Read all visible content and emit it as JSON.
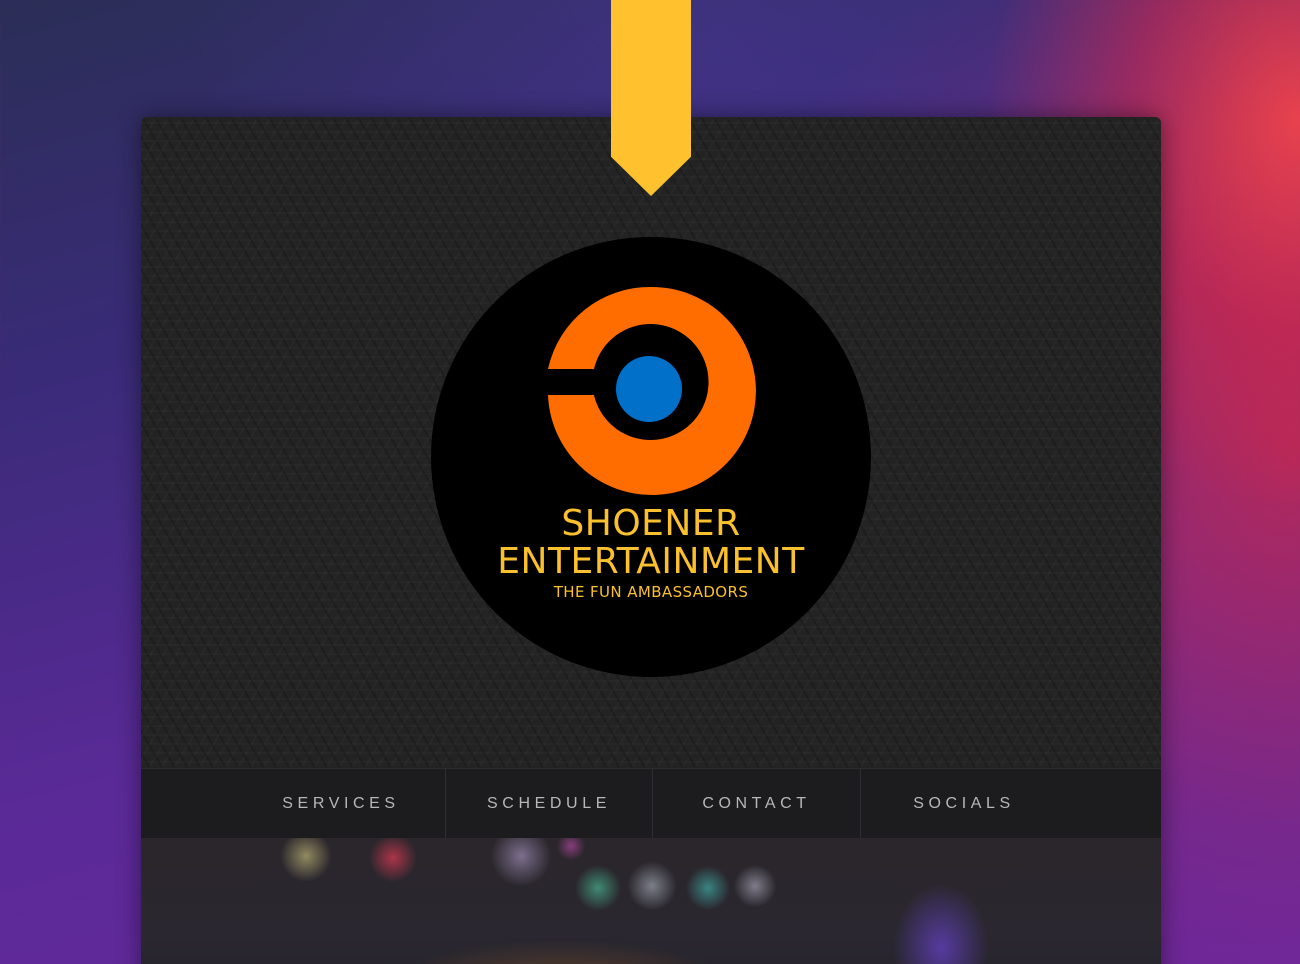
{
  "brand": {
    "name_line1": "SHOENER",
    "name_line2": "ENTERTAINMENT",
    "tagline": "THE FUN AMBASSADORS",
    "logo_mark": "orange-c-with-blue-dot-icon"
  },
  "nav": {
    "items": [
      {
        "label": "SERVICES"
      },
      {
        "label": "SCHEDULE"
      },
      {
        "label": "CONTACT"
      },
      {
        "label": "SOCIALS"
      }
    ]
  },
  "colors": {
    "accent_yellow": "#ffc12e",
    "logo_orange": "#ff6d00",
    "logo_blue": "#0070c9",
    "logo_text": "#fbc02d",
    "panel": "#232323",
    "nav_bg": "#1c1c1e",
    "nav_text": "#b7b7b7"
  }
}
